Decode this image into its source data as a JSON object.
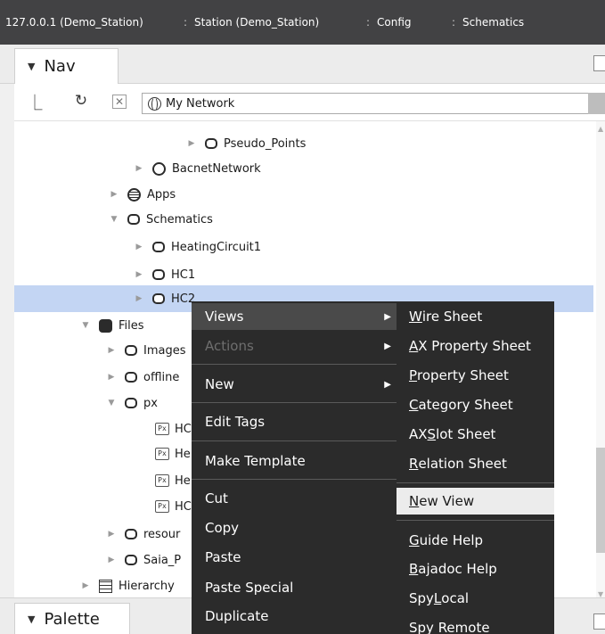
{
  "breadcrumb": [
    {
      "label": "127.0.0.1 (Demo_Station)"
    },
    {
      "label": "Station (Demo_Station)"
    },
    {
      "label": "Config"
    },
    {
      "label": "Schematics"
    }
  ],
  "nav_pane": {
    "tab_label": "Nav",
    "network_select_value": "My Network"
  },
  "palette_pane": {
    "tab_label": "Palette"
  },
  "tree": [
    {
      "label": "Pseudo_Points",
      "icon": "folder-icon",
      "expanded": false
    },
    {
      "label": "BacnetNetwork",
      "icon": "network-icon",
      "expanded": false
    },
    {
      "label": "Apps",
      "icon": "apps-icon",
      "expanded": false
    },
    {
      "label": "Schematics",
      "icon": "folder-icon",
      "expanded": true
    },
    {
      "label": "HeatingCircuit1",
      "icon": "folder-icon",
      "expanded": false
    },
    {
      "label": "HC1",
      "icon": "folder-icon",
      "expanded": false
    },
    {
      "label": "HC2",
      "icon": "folder-icon",
      "expanded": false,
      "selected": true
    },
    {
      "label": "Files",
      "icon": "files-icon",
      "expanded": true
    },
    {
      "label": "Images",
      "icon": "folder-icon",
      "expanded": false
    },
    {
      "label": "offline",
      "icon": "folder-icon",
      "expanded": false
    },
    {
      "label": "px",
      "icon": "folder-icon",
      "expanded": true
    },
    {
      "label": "HC",
      "icon": "px-file-icon"
    },
    {
      "label": "He",
      "icon": "px-file-icon"
    },
    {
      "label": "He",
      "icon": "px-file-icon"
    },
    {
      "label": "HC",
      "icon": "px-file-icon"
    },
    {
      "label": "resour",
      "icon": "folder-icon",
      "expanded": false
    },
    {
      "label": "Saia_P",
      "icon": "folder-icon",
      "expanded": false
    },
    {
      "label": "Hierarchy",
      "icon": "hierarchy-icon",
      "expanded": false
    }
  ],
  "context_menu": {
    "items": [
      {
        "label": "Views",
        "submenu": true,
        "highlighted": true
      },
      {
        "label": "Actions",
        "submenu": true,
        "disabled": true
      },
      {
        "label": "New",
        "submenu": true
      },
      {
        "label": "Edit Tags"
      },
      {
        "label": "Make Template"
      },
      {
        "label": "Cut"
      },
      {
        "label": "Copy"
      },
      {
        "label": "Paste"
      },
      {
        "label": "Paste Special"
      },
      {
        "label": "Duplicate"
      }
    ]
  },
  "views_submenu": {
    "items": [
      {
        "pre": "",
        "u": "W",
        "post": "ire Sheet"
      },
      {
        "pre": "",
        "u": "A",
        "post": "X Property Sheet"
      },
      {
        "pre": "",
        "u": "P",
        "post": "roperty Sheet"
      },
      {
        "pre": "",
        "u": "C",
        "post": "ategory Sheet"
      },
      {
        "pre": "AX ",
        "u": "S",
        "post": "lot Sheet"
      },
      {
        "pre": "",
        "u": "R",
        "post": "elation Sheet"
      },
      {
        "pre": "",
        "u": "N",
        "post": "ew View",
        "active": true
      },
      {
        "pre": "",
        "u": "G",
        "post": "uide Help"
      },
      {
        "pre": "",
        "u": "B",
        "post": "ajadoc Help"
      },
      {
        "pre": "Spy ",
        "u": "L",
        "post": "ocal"
      },
      {
        "pre": "Spy Remote",
        "u": "",
        "post": ""
      }
    ]
  },
  "colors": {
    "menu_bg": "#2b2b2b",
    "selection": "#c3d5f3",
    "breadcrumb_bg": "#424244"
  }
}
